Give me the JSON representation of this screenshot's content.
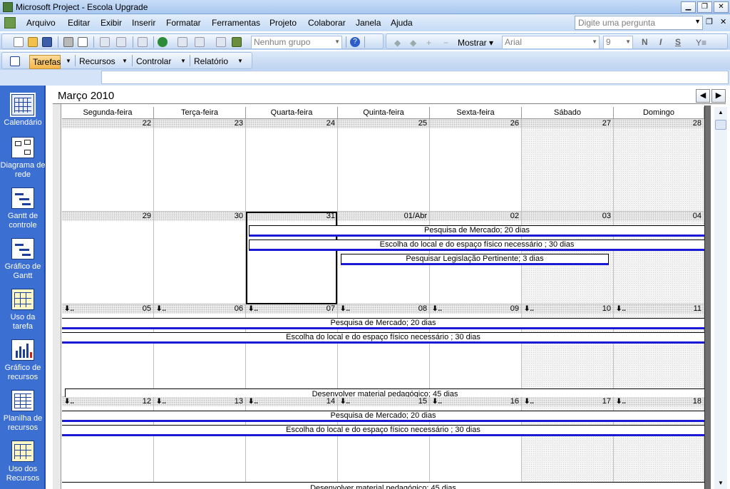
{
  "window": {
    "title": "Microsoft Project - Escola Upgrade"
  },
  "menu": {
    "items": [
      "Arquivo",
      "Editar",
      "Exibir",
      "Inserir",
      "Formatar",
      "Ferramentas",
      "Projeto",
      "Colaborar",
      "Janela",
      "Ajuda"
    ],
    "ask_placeholder": "Digite uma pergunta"
  },
  "toolbar": {
    "group_value": "Nenhum grupo",
    "mostrar_label": "Mostrar",
    "font_value": "Arial",
    "size_value": "9",
    "bold": "N",
    "italic": "I",
    "underline": "S"
  },
  "guide": {
    "tarefas": "Tarefas",
    "recursos": "Recursos",
    "controlar": "Controlar",
    "relatorio": "Relatório"
  },
  "viewbar": {
    "items": [
      "Calendário",
      "Diagrama de rede",
      "Gantt de controle",
      "Gráfico de Gantt",
      "Uso da tarefa",
      "Gráfico de recursos",
      "Planilha de recursos",
      "Uso dos Recursos"
    ]
  },
  "calendar": {
    "month": "Março 2010",
    "days": [
      "Segunda-feira",
      "Terça-feira",
      "Quarta-feira",
      "Quinta-feira",
      "Sexta-feira",
      "Sábado",
      "Domingo"
    ],
    "weeks": [
      [
        "22",
        "23",
        "24",
        "25",
        "26",
        "27",
        "28"
      ],
      [
        "29",
        "30",
        "31",
        "01/Abr",
        "02",
        "03",
        "04"
      ],
      [
        "05",
        "06",
        "07",
        "08",
        "09",
        "10",
        "11"
      ],
      [
        "12",
        "13",
        "14",
        "15",
        "16",
        "17",
        "18"
      ]
    ],
    "tasks": {
      "mercado": "Pesquisa de Mercado; 20 dias",
      "local": "Escolha do local e do espaço físico necessário ; 30 dias",
      "legislacao": "Pesquisar Legislação Pertinente; 3 dias",
      "material": "Desenvolver material pedagógico; 45 dias"
    }
  }
}
